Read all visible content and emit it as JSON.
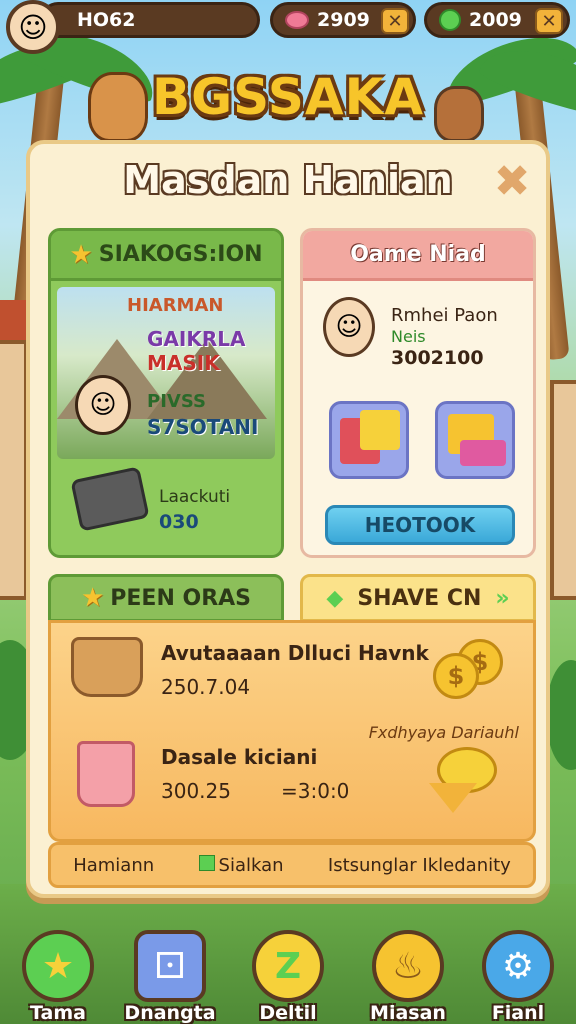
{
  "top_bar": {
    "player_name": "HO62",
    "currency_pink": "2909",
    "currency_green": "2009"
  },
  "game_title": "BGSSAKA",
  "panel": {
    "title": "Masdan Hanian",
    "left_card": {
      "header": "SIAKOGS:ION",
      "scene_line1": "HIARMAN",
      "scene_line2": "GAIKRLA",
      "scene_line3": "MASIK",
      "scene_line4": "PIVSS",
      "scene_line5": "S7SOTANI",
      "item_name": "Laackuti",
      "item_value": "030"
    },
    "right_card": {
      "header": "Oame Niad",
      "player_name": "Rmhei Paon",
      "player_tag": "Neis",
      "player_score": "3002100",
      "button_label": "HEOTOOK"
    },
    "tabs": {
      "left": "PEEN ORAS",
      "right": "SHAVE CN"
    },
    "items": [
      {
        "title": "Avutaaaan Dlluci Havnk",
        "value": "250.7.04"
      },
      {
        "title": "Dasale kiciani",
        "value_a": "300.25",
        "value_b": "=3:0:0"
      }
    ],
    "side_note": "Fxdhyaya Dariauhl",
    "footer": {
      "a": "Hamiann",
      "b": "Sialkan",
      "c": "Istsunglar Ikledanity"
    }
  },
  "bottom_nav": [
    {
      "label": "Tama",
      "icon": "star-icon"
    },
    {
      "label": "Dnangta",
      "icon": "dice-icon"
    },
    {
      "label": "Deltil",
      "icon": "z-icon"
    },
    {
      "label": "Miasan",
      "icon": "pot-icon"
    },
    {
      "label": "Fianl",
      "icon": "settings-icon"
    }
  ],
  "colors": {
    "title_gold": "#f7c52a",
    "panel_bg": "#fbf0d2",
    "green_card": "#8fca5c",
    "pink_card_header": "#f2a8a0",
    "blue_button": "#3aa8d8"
  }
}
